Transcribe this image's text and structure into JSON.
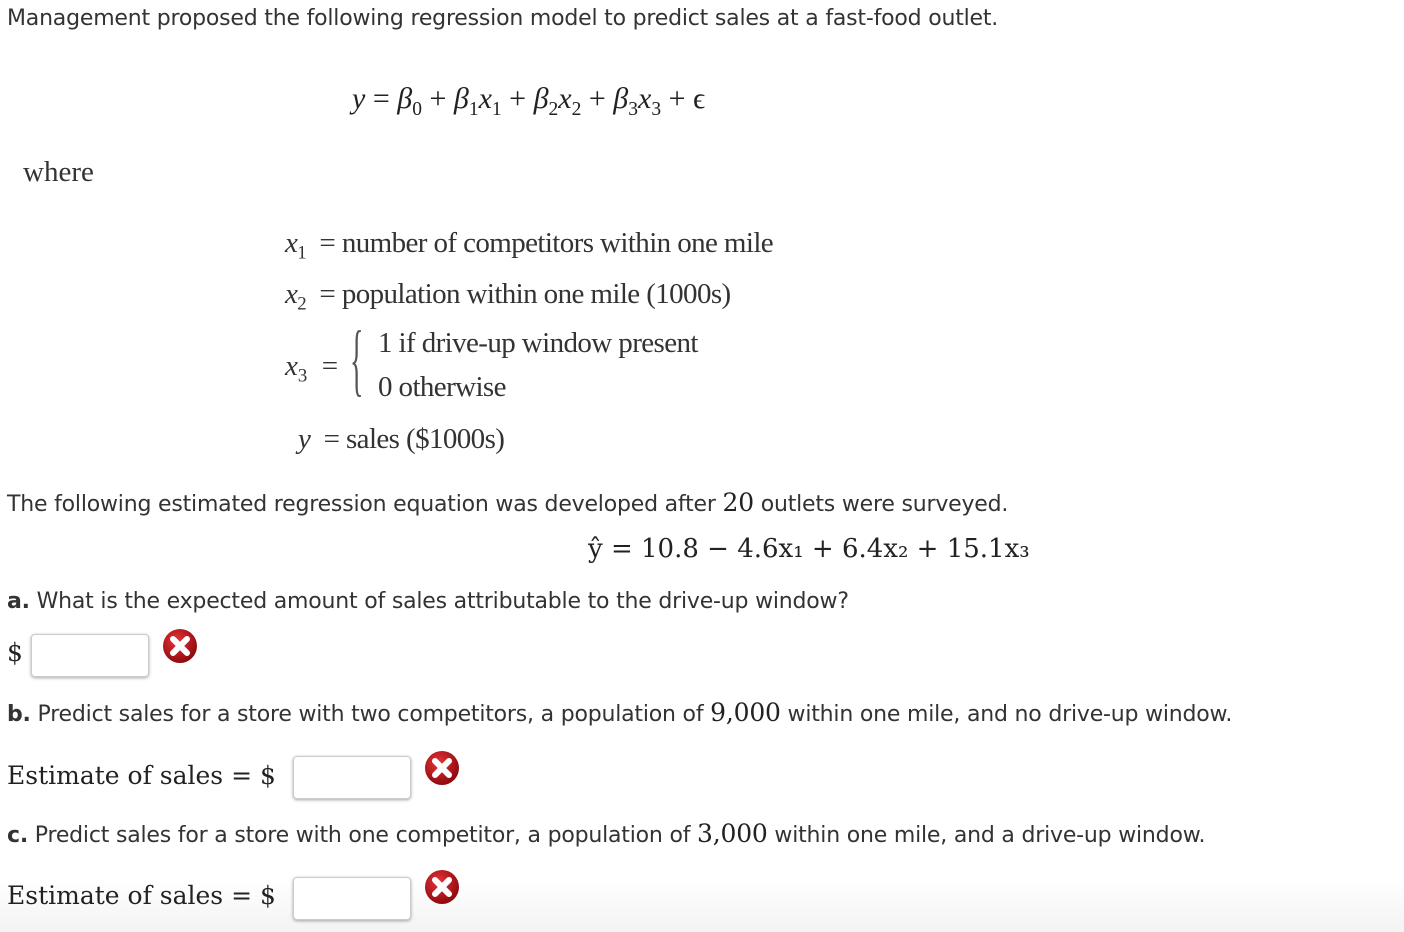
{
  "intro": "Management proposed the following regression model to predict sales at a fast-food outlet.",
  "model": {
    "lhs": "y",
    "eq": "=",
    "terms": [
      "β",
      "0",
      "+",
      "β",
      "1",
      "x",
      "1",
      "+",
      "β",
      "2",
      "x",
      "2",
      "+",
      "β",
      "3",
      "x",
      "3",
      "+",
      "ϵ"
    ]
  },
  "where_label": "where",
  "definitions": [
    {
      "var": "x",
      "sub": "1",
      "text": "number of competitors within one mile"
    },
    {
      "var": "x",
      "sub": "2",
      "text": "population within one mile (1000s)"
    },
    {
      "var": "x",
      "sub": "3",
      "case1": "1 if drive-up window present",
      "case2": "0 otherwise"
    },
    {
      "var": "y",
      "sub": "",
      "text": "sales ($1000s)"
    }
  ],
  "estimated_intro": {
    "before": "The following estimated regression equation was developed after ",
    "n": "20",
    "after": " outlets were surveyed."
  },
  "estimated_equation": "ŷ = 10.8 − 4.6x₁ + 6.4x₂ + 15.1x₃",
  "questions": {
    "a": {
      "label": "a.",
      "text": " What is the expected amount of sales attributable to the drive-up window?",
      "prefix": "$",
      "value": "",
      "status": "incorrect"
    },
    "b": {
      "label": "b.",
      "text_before": " Predict sales for a store with two competitors, a population of ",
      "number": "9,000",
      "text_after": " within one mile, and no drive-up window.",
      "answer_label": "Estimate of sales = $",
      "value": "",
      "status": "incorrect"
    },
    "c": {
      "label": "c.",
      "text_before": " Predict sales for a store with one competitor, a population of ",
      "number": "3,000",
      "text_after": " within one mile, and a drive-up window.",
      "answer_label": "Estimate of sales = $",
      "value": "",
      "status": "incorrect"
    }
  },
  "colors": {
    "incorrect_icon": "#c0141a"
  }
}
